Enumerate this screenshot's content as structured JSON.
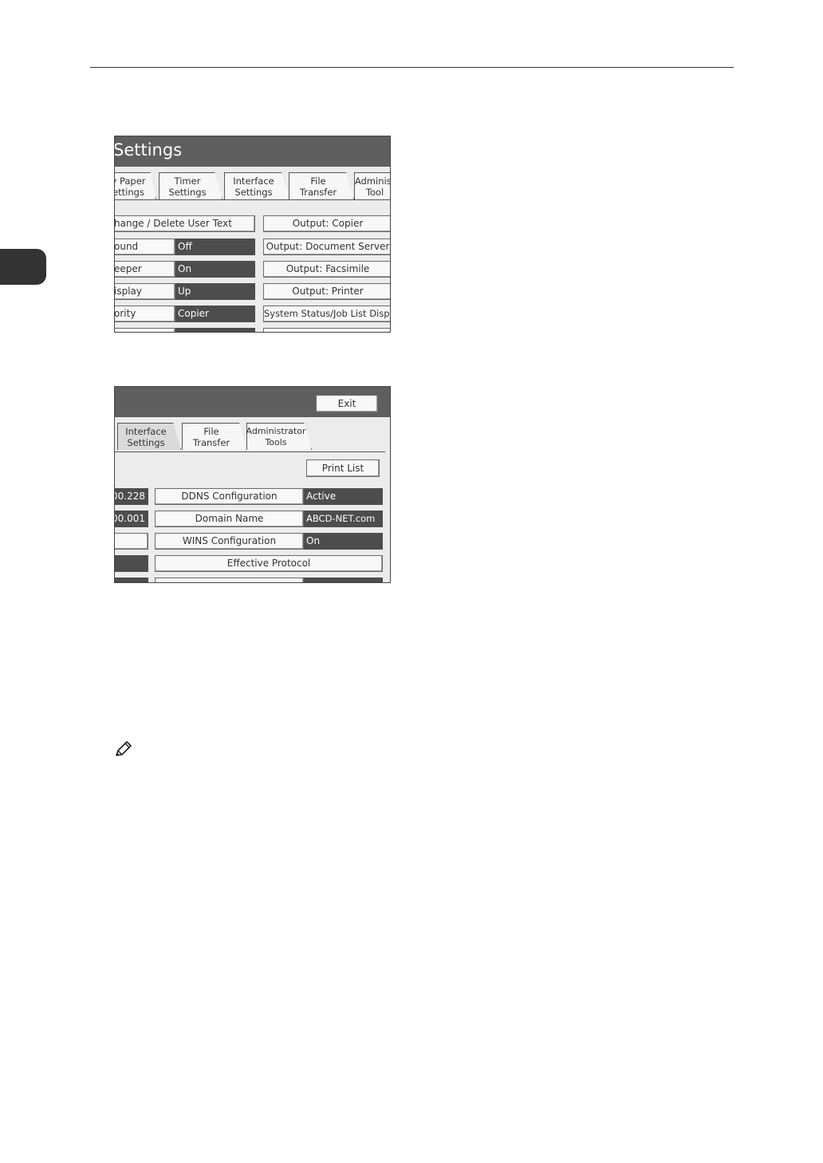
{
  "screen1": {
    "title": "Settings",
    "tabs": [
      {
        "label": "y Paper\nettings"
      },
      {
        "label": "Timer\nSettings"
      },
      {
        "label": "Interface\nSettings"
      },
      {
        "label": "File\nTransfer"
      },
      {
        "label": "Administ\nTool"
      }
    ],
    "rows": [
      {
        "label": "hange / Delete User Text",
        "value": "",
        "right": "Output: Copier"
      },
      {
        "label": "ound",
        "value": "Off",
        "right": "Output: Document Server"
      },
      {
        "label": "eeper",
        "value": "On",
        "right": "Output: Facsimile"
      },
      {
        "label": "isplay",
        "value": "Up",
        "right": "Output: Printer"
      },
      {
        "label": "ority",
        "value": "Copier",
        "right": "System Status/Job List Display"
      }
    ]
  },
  "screen2": {
    "exit_label": "Exit",
    "tabs": [
      {
        "label": "Interface\nSettings"
      },
      {
        "label": "File\nTransfer"
      },
      {
        "label": "Administrator\nTools"
      }
    ],
    "print_list_label": "Print List",
    "left_values": [
      "00.228",
      "00.001"
    ],
    "rows": [
      {
        "label": "DDNS Configuration",
        "value": "Active"
      },
      {
        "label": "Domain Name",
        "value": "ABCD-NET.com"
      },
      {
        "label": "WINS Configuration",
        "value": "On"
      }
    ],
    "effective_protocol_label": "Effective Protocol"
  },
  "icons": {
    "note": "pencil-note-icon"
  }
}
